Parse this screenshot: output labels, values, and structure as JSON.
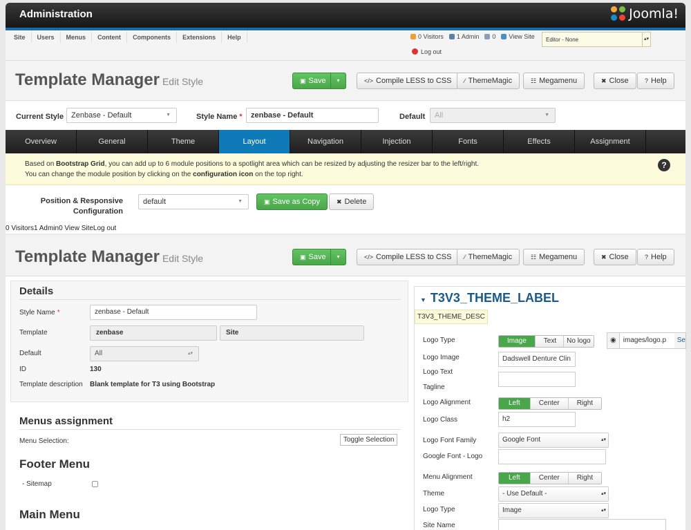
{
  "topbar": {
    "title": "Administration",
    "brand": "Joomla!"
  },
  "menu": [
    "Site",
    "Users",
    "Menus",
    "Content",
    "Components",
    "Extensions",
    "Help"
  ],
  "status": {
    "visitors": "0 Visitors",
    "admin": "1 Admin",
    "messages": "0",
    "view_site": "View Site",
    "logout": "Log out"
  },
  "editor_select": "Editor - None",
  "header": {
    "title": "Template Manager",
    "subtitle": "Edit Style",
    "save": "Save",
    "compile": "Compile LESS to CSS",
    "thememagic": "ThemeMagic",
    "megamenu": "Megamenu",
    "close": "Close",
    "help": "Help"
  },
  "style_row": {
    "current_style_label": "Current Style",
    "current_style_value": "Zenbase - Default",
    "style_name_label": "Style Name",
    "style_name_value": "zenbase - Default",
    "default_label": "Default",
    "default_value": "All"
  },
  "tabs": [
    "Overview",
    "General",
    "Theme",
    "Layout",
    "Navigation",
    "Injection",
    "Fonts",
    "Effects",
    "Assignment"
  ],
  "info": {
    "l1_a": "Based on ",
    "l1_b": "Bootstrap Grid",
    "l1_c": ", you can add up to 6 module positions to a spotlight area which can be resized by adjusting the resizer bar to the left/right.",
    "l2_a": "You can change the module position by clicking on the ",
    "l2_b": "configuration icon",
    "l2_c": " on the top right."
  },
  "position_config": {
    "label_1": "Position & Responsive",
    "label_2": "Configuration",
    "select": "default",
    "save_copy": "Save as Copy",
    "delete": "Delete"
  },
  "stray_status": "0 Visitors1 Admin0 View SiteLog out",
  "details": {
    "title": "Details",
    "style_name_label": "Style Name",
    "style_name_value": "zenbase - Default",
    "template_label": "Template",
    "template_value": "zenbase",
    "template_client": "Site",
    "default_label": "Default",
    "default_value": "All",
    "id_label": "ID",
    "id_value": "130",
    "desc_label": "Template description",
    "desc_value": "Blank template for T3 using Bootstrap"
  },
  "menus_assignment": {
    "title": "Menus assignment",
    "menu_selection": "Menu Selection:",
    "toggle": "Toggle Selection",
    "footer_menu": "Footer Menu",
    "sitemap": "- Sitemap",
    "main_menu": "Main Menu"
  },
  "theme_panel": {
    "title": "T3V3_THEME_LABEL",
    "desc": "T3V3_THEME_DESC",
    "logo_type_label": "Logo Type",
    "logo_type_options": [
      "Image",
      "Text",
      "No logo"
    ],
    "logo_path": "images/logo.p",
    "logo_path_btn": "Se",
    "logo_image_label": "Logo Image",
    "logo_image_value": "Dadswell Denture Clin",
    "logo_text_label": "Logo Text",
    "tagline_label": "Tagline",
    "logo_alignment_label": "Logo Alignment",
    "alignment_options": [
      "Left",
      "Center",
      "Right"
    ],
    "logo_class_label": "Logo Class",
    "logo_class_value": "h2",
    "logo_font_family_label": "Logo Font Family",
    "logo_font_family_value": "Google Font",
    "google_font_logo_label": "Google Font - Logo",
    "menu_alignment_label": "Menu Alignment",
    "theme_label": "Theme",
    "theme_value": "- Use Default -",
    "logo_type2_label": "Logo Type",
    "logo_type2_value": "Image",
    "site_name_label": "Site Name"
  },
  "colors": {
    "accent_green": "#4aa64a",
    "tab_active": "#0e7bb8",
    "info_bg": "#fcfbdb"
  }
}
